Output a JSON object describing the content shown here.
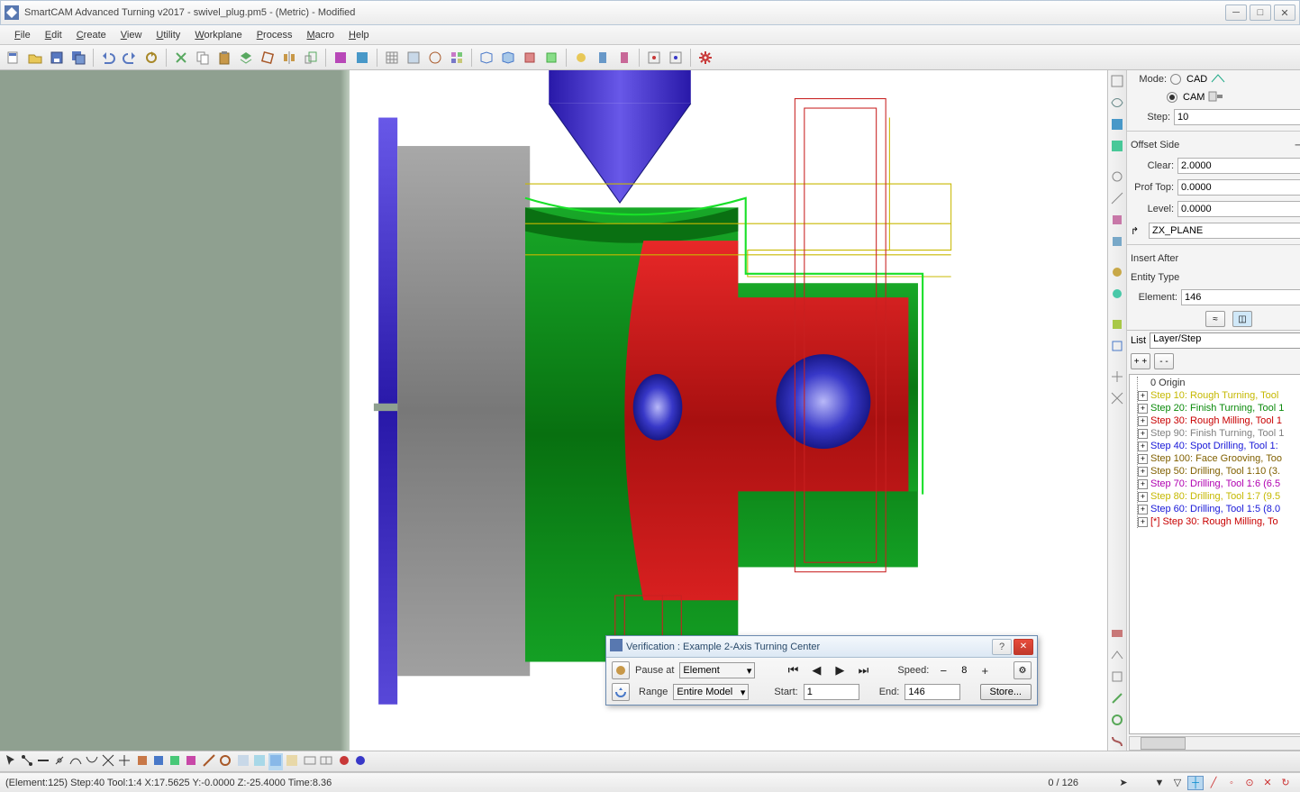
{
  "app": {
    "title": "SmartCAM Advanced Turning v2017 - swivel_plug.pm5 - (Metric) - Modified"
  },
  "menu": {
    "items": [
      "File",
      "Edit",
      "Create",
      "View",
      "Utility",
      "Workplane",
      "Process",
      "Macro",
      "Help"
    ]
  },
  "props": {
    "mode_label": "Mode:",
    "mode_cad": "CAD",
    "mode_cam": "CAM",
    "step_label": "Step:",
    "step_value": "10",
    "offset_label": "Offset Side",
    "clear_label": "Clear:",
    "clear_value": "2.0000",
    "proftop_label": "Prof Top:",
    "proftop_value": "0.0000",
    "level_label": "Level:",
    "level_value": "0.0000",
    "plane_value": "ZX_PLANE",
    "insert_after_label": "Insert After",
    "entity_type_label": "Entity Type",
    "element_label": "Element:",
    "element_value": "146"
  },
  "list": {
    "label": "List",
    "selected": "Layer/Step",
    "expand_all": "+ +",
    "collapse_all": "- -",
    "nodes": [
      {
        "text": "0 Origin",
        "color": "#333",
        "exp": ""
      },
      {
        "text": "Step 10: Rough Turning, Tool",
        "color": "#c5b800",
        "exp": "+"
      },
      {
        "text": "Step 20: Finish Turning, Tool 1",
        "color": "#0a8a0a",
        "exp": "+"
      },
      {
        "text": "Step 30: Rough Milling, Tool 1",
        "color": "#c80000",
        "exp": "+"
      },
      {
        "text": "Step 90: Finish Turning, Tool 1",
        "color": "#808080",
        "exp": "+"
      },
      {
        "text": "Step 40: Spot Drilling, Tool 1:",
        "color": "#1818d8",
        "exp": "+"
      },
      {
        "text": "Step 100: Face Grooving, Too",
        "color": "#806000",
        "exp": "+"
      },
      {
        "text": "Step 50: Drilling, Tool 1:10 (3.",
        "color": "#806000",
        "exp": "+"
      },
      {
        "text": "Step 70: Drilling, Tool 1:6 (6.5",
        "color": "#b000b0",
        "exp": "+"
      },
      {
        "text": "Step 80: Drilling, Tool 1:7 (9.5",
        "color": "#c5b800",
        "exp": "+"
      },
      {
        "text": "Step 60: Drilling, Tool 1:5 (8.0",
        "color": "#1818d8",
        "exp": "+"
      },
      {
        "text": "[*] Step 30: Rough Milling, To",
        "color": "#c80000",
        "exp": "+"
      }
    ]
  },
  "verification": {
    "title": "Verification : Example 2-Axis Turning Center",
    "pause_at_label": "Pause at",
    "pause_at_value": "Element",
    "range_label": "Range",
    "range_value": "Entire Model",
    "start_label": "Start:",
    "start_value": "1",
    "end_label": "End:",
    "end_value": "146",
    "speed_label": "Speed:",
    "speed_value": "8",
    "store_label": "Store..."
  },
  "status": {
    "text": "(Element:125) Step:40 Tool:1:4 X:17.5625 Y:-0.0000 Z:-25.4000 Time:8.36",
    "count": "0 / 126"
  },
  "colors": {
    "red": "#c81818",
    "green": "#0a9018",
    "blue": "#2828c8",
    "purple": "#4a38c8",
    "grey": "#909090"
  }
}
